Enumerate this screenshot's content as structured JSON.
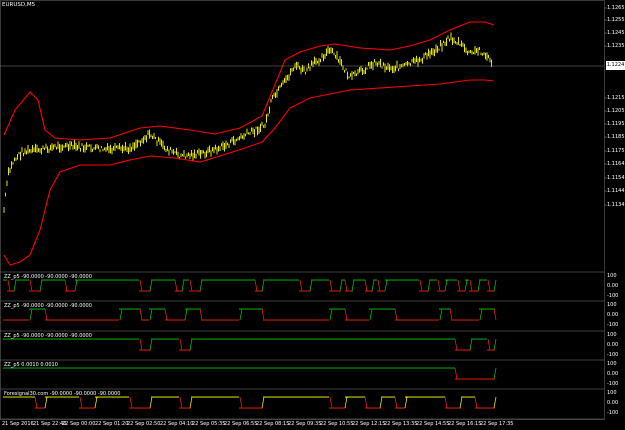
{
  "symbol": "EURUSD,M5",
  "current_price": "1.1224",
  "price_axis_ticks": [
    "1.1265",
    "1.1255",
    "1.1245",
    "1.1235",
    "1.1215",
    "1.1205",
    "1.1195",
    "1.1185",
    "1.1175",
    "1.1164",
    "1.1154",
    "1.1144",
    "1.1134"
  ],
  "time_axis_ticks": [
    "21 Sep 2016",
    "21 Sep 22:40",
    "22 Sep 00:00",
    "22 Sep 01:20",
    "22 Sep 02:50",
    "22 Sep 04:10",
    "22 Sep 05:35",
    "22 Sep 06:55",
    "22 Sep 08:15",
    "22 Sep 09:35",
    "22 Sep 10:55",
    "22 Sep 12:15",
    "22 Sep 13:35",
    "22 Sep 14:55",
    "22 Sep 16:15",
    "22 Sep 17:35"
  ],
  "indicator_panes": [
    {
      "title": "ZZ_p5 -90.0000 -90.0000 -90.0000",
      "ticks": [
        "100",
        "0.00",
        "-100"
      ]
    },
    {
      "title": "ZZ_p5 -90.0000 -90.0000 -90.0000",
      "ticks": [
        "100",
        "0.00",
        "-100"
      ]
    },
    {
      "title": "ZZ_p5 -90.0000 -90.0000 -90.0000",
      "ticks": [
        "100",
        "0.00",
        "-100"
      ]
    },
    {
      "title": "ZZ_p5 0.0010 0.0010",
      "ticks": [
        "100",
        "0.00",
        "-100"
      ]
    },
    {
      "title": "Foresignal30.com -90.0000 -90.0000 -90.0000",
      "ticks": [
        "100",
        "0.00",
        "-100"
      ]
    }
  ],
  "colors": {
    "candle": "#ffff00",
    "band": "#ff0000",
    "up": "#00cc00",
    "down": "#ff2200",
    "background": "#000000",
    "grid": "#808080"
  }
}
